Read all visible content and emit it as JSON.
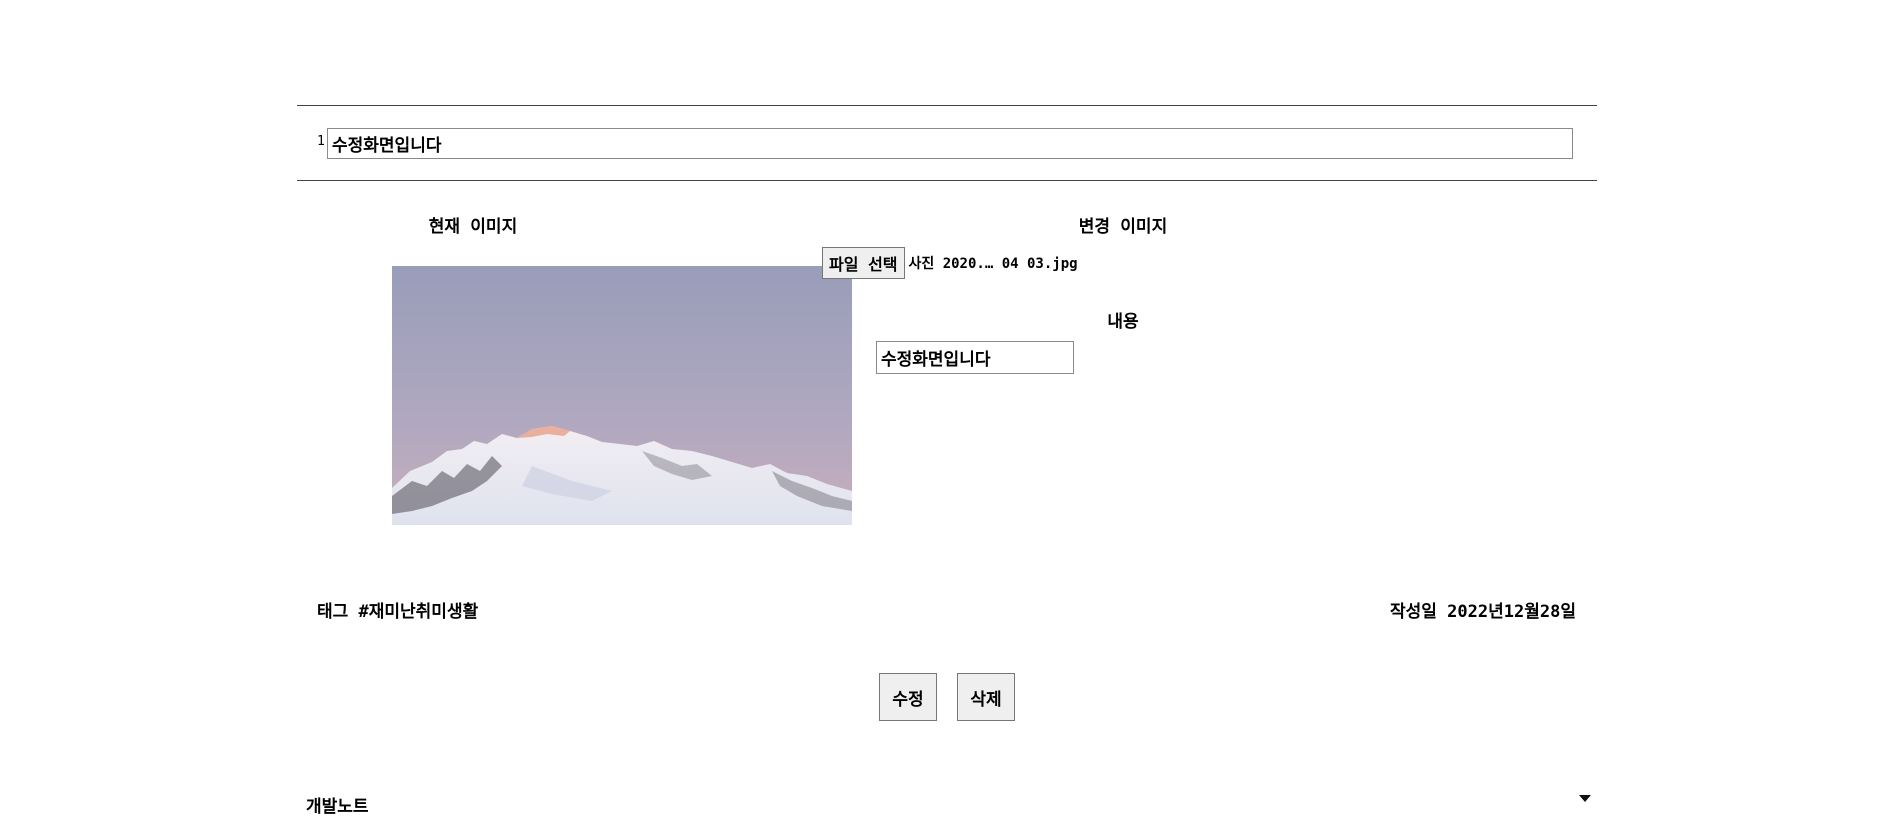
{
  "post": {
    "number": "1",
    "title_value": "수정화면입니다"
  },
  "current_image": {
    "heading": "현재 이미지"
  },
  "change_image": {
    "heading": "변경 이미지",
    "file_button": "파일 선택",
    "file_name": "사진 2020.… 04 03.jpg"
  },
  "content": {
    "label": "내용",
    "value": "수정화면입니다"
  },
  "meta": {
    "tag": "태그 #재미난취미생활",
    "date": "작성일 2022년12월28일"
  },
  "actions": {
    "edit_label": "수정",
    "delete_label": "삭제"
  },
  "footer": {
    "note": "개발노트"
  }
}
